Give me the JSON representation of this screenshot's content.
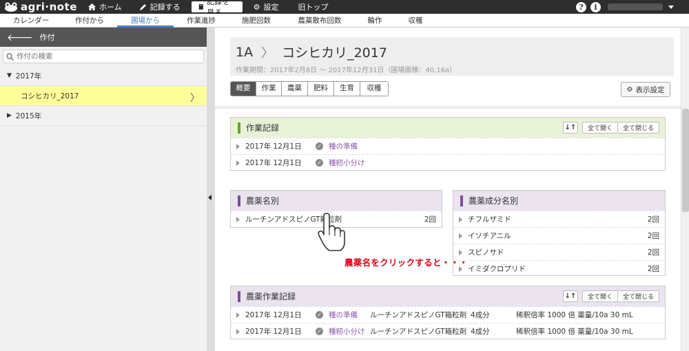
{
  "topbar": {
    "logo_text": "agri·note",
    "nav": [
      {
        "label": "ホーム",
        "icon": "home-icon"
      },
      {
        "label": "記録する",
        "icon": "pen-icon"
      },
      {
        "label": "記録を見る",
        "icon": "book-icon",
        "active": true
      },
      {
        "label": "設定",
        "icon": "gear-icon"
      },
      {
        "label": "旧トップ",
        "icon": ""
      }
    ],
    "help": "?",
    "info": "i"
  },
  "subnav": {
    "tabs": [
      "カレンダー",
      "作付から",
      "圃場から",
      "作業進捗",
      "施肥回数",
      "農薬散布回数",
      "輪作",
      "収穫"
    ],
    "active": 2
  },
  "sidebar": {
    "header": "作付",
    "search_placeholder": "作付の検索",
    "groups": [
      {
        "label": "2017年",
        "expanded": true,
        "items": [
          {
            "label": "コシヒカリ_2017"
          }
        ]
      },
      {
        "label": "2015年",
        "expanded": false
      }
    ]
  },
  "main": {
    "field": "1A",
    "crop": "コシヒカリ_2017",
    "period": "作業期間：2017年2月8日 〜 2017年12月31日（圃場面積：40.16a）",
    "tabs": [
      "概要",
      "作業",
      "農薬",
      "肥料",
      "生育",
      "収穫"
    ],
    "active_tab": 0,
    "display_settings": "表示設定"
  },
  "work_records": {
    "title": "作業記録",
    "sort": "↓↑",
    "expand_all": "全て開く",
    "collapse_all": "全て閉じる",
    "rows": [
      {
        "date": "2017年 12月1日",
        "task": "種の準備"
      },
      {
        "date": "2017年 12月1日",
        "task": "種籾小分け"
      }
    ]
  },
  "pesticide_names": {
    "title": "農薬名別",
    "rows": [
      {
        "name": "ルーチンアドスピノGT箱粒剤",
        "count": "2回"
      }
    ]
  },
  "pesticide_ingredients": {
    "title": "農薬成分名別",
    "rows": [
      {
        "name": "チフルザミド",
        "count": "2回"
      },
      {
        "name": "イソチアニル",
        "count": "2回"
      },
      {
        "name": "スピノサド",
        "count": "2回"
      },
      {
        "name": "イミダクロプリド",
        "count": "2回"
      }
    ]
  },
  "pesticide_work": {
    "title": "農薬作業記録",
    "sort": "↓↑",
    "expand_all": "全て開く",
    "collapse_all": "全て閉じる",
    "rows": [
      {
        "date": "2017年 12月1日",
        "task": "種の準備",
        "product": "ルーチンアドスピノGT箱粒剤",
        "components": "4成分",
        "dilution": "稀釈倍率 1000 倍 薬量/10a 30 mL"
      },
      {
        "date": "2017年 12月1日",
        "task": "種籾小分け",
        "product": "ルーチンアドスピノGT箱粒剤",
        "components": "4成分",
        "dilution": "稀釈倍率 1000 倍 薬量/10a 30 mL"
      }
    ]
  },
  "annotation": "農薬名をクリックすると・・・",
  "colors": {
    "work_accent": "#6aa31f",
    "work_header_bg": "#e8f2d8",
    "pesticide_accent": "#7a4f9a",
    "pesticide_header_bg": "#ebe4ef",
    "annotation": "#e0001a",
    "selected_bg": "#ffff99"
  }
}
